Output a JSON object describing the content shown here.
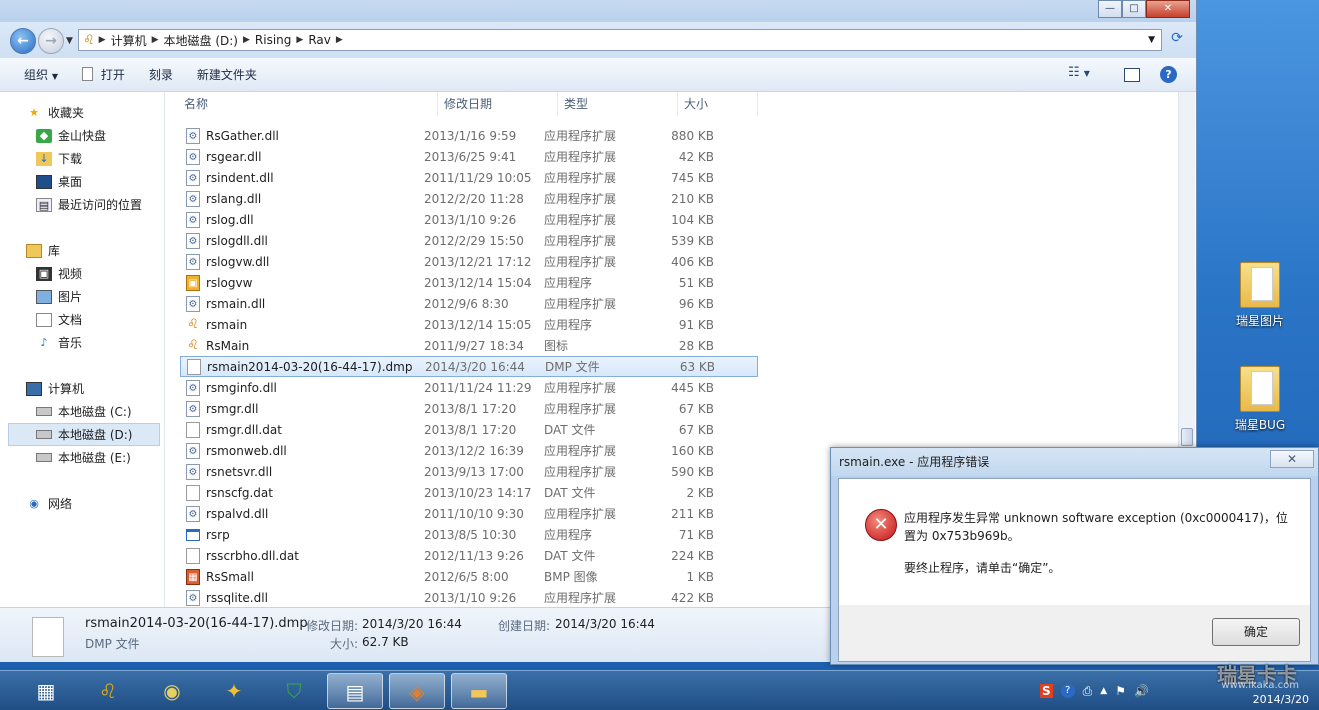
{
  "desktop": {
    "icons": [
      {
        "label": "瑞星图片"
      },
      {
        "label": "瑞星BUG"
      }
    ]
  },
  "explorer": {
    "window_buttons": {
      "minimize": "—",
      "maximize": "□",
      "close": "✕"
    },
    "address": {
      "crumbs": [
        "计算机",
        "本地磁盘 (D:)",
        "Rising",
        "Rav"
      ]
    },
    "toolbar": {
      "organize": "组织",
      "open": "打开",
      "burn": "刻录",
      "new_folder": "新建文件夹"
    },
    "nav": {
      "favorites": "收藏夹",
      "kingsoft": "金山快盘",
      "downloads": "下载",
      "desktop": "桌面",
      "recent": "最近访问的位置",
      "libraries": "库",
      "videos": "视频",
      "pictures": "图片",
      "documents": "文档",
      "music": "音乐",
      "computer": "计算机",
      "drive_c": "本地磁盘 (C:)",
      "drive_d": "本地磁盘 (D:)",
      "drive_e": "本地磁盘 (E:)",
      "network": "网络"
    },
    "columns": {
      "name": "名称",
      "date": "修改日期",
      "type": "类型",
      "size": "大小"
    },
    "files": [
      {
        "name": "RsGather.dll",
        "date": "2013/1/16 9:59",
        "type": "应用程序扩展",
        "size": "880 KB",
        "icon": "dll"
      },
      {
        "name": "rsgear.dll",
        "date": "2013/6/25 9:41",
        "type": "应用程序扩展",
        "size": "42 KB",
        "icon": "dll"
      },
      {
        "name": "rsindent.dll",
        "date": "2011/11/29 10:05",
        "type": "应用程序扩展",
        "size": "745 KB",
        "icon": "dll"
      },
      {
        "name": "rslang.dll",
        "date": "2012/2/20 11:28",
        "type": "应用程序扩展",
        "size": "210 KB",
        "icon": "dll"
      },
      {
        "name": "rslog.dll",
        "date": "2013/1/10 9:26",
        "type": "应用程序扩展",
        "size": "104 KB",
        "icon": "dll"
      },
      {
        "name": "rslogdll.dll",
        "date": "2012/2/29 15:50",
        "type": "应用程序扩展",
        "size": "539 KB",
        "icon": "dll"
      },
      {
        "name": "rslogvw.dll",
        "date": "2013/12/21 17:12",
        "type": "应用程序扩展",
        "size": "406 KB",
        "icon": "dll"
      },
      {
        "name": "rslogvw",
        "date": "2013/12/14 15:04",
        "type": "应用程序",
        "size": "51 KB",
        "icon": "exe"
      },
      {
        "name": "rsmain.dll",
        "date": "2012/9/6 8:30",
        "type": "应用程序扩展",
        "size": "96 KB",
        "icon": "dll"
      },
      {
        "name": "rsmain",
        "date": "2013/12/14 15:05",
        "type": "应用程序",
        "size": "91 KB",
        "icon": "lion"
      },
      {
        "name": "RsMain",
        "date": "2011/9/27 18:34",
        "type": "图标",
        "size": "28 KB",
        "icon": "lion"
      },
      {
        "name": "rsmain2014-03-20(16-44-17).dmp",
        "date": "2014/3/20 16:44",
        "type": "DMP 文件",
        "size": "63 KB",
        "icon": "file"
      },
      {
        "name": "rsmginfo.dll",
        "date": "2011/11/24 11:29",
        "type": "应用程序扩展",
        "size": "445 KB",
        "icon": "dll"
      },
      {
        "name": "rsmgr.dll",
        "date": "2013/8/1 17:20",
        "type": "应用程序扩展",
        "size": "67 KB",
        "icon": "dll"
      },
      {
        "name": "rsmgr.dll.dat",
        "date": "2013/8/1 17:20",
        "type": "DAT 文件",
        "size": "67 KB",
        "icon": "file"
      },
      {
        "name": "rsmonweb.dll",
        "date": "2013/12/2 16:39",
        "type": "应用程序扩展",
        "size": "160 KB",
        "icon": "dll"
      },
      {
        "name": "rsnetsvr.dll",
        "date": "2013/9/13 17:00",
        "type": "应用程序扩展",
        "size": "590 KB",
        "icon": "dll"
      },
      {
        "name": "rsnscfg.dat",
        "date": "2013/10/23 14:17",
        "type": "DAT 文件",
        "size": "2 KB",
        "icon": "file"
      },
      {
        "name": "rspalvd.dll",
        "date": "2011/10/10 9:30",
        "type": "应用程序扩展",
        "size": "211 KB",
        "icon": "dll"
      },
      {
        "name": "rsrp",
        "date": "2013/8/5 10:30",
        "type": "应用程序",
        "size": "71 KB",
        "icon": "window"
      },
      {
        "name": "rsscrbho.dll.dat",
        "date": "2012/11/13 9:26",
        "type": "DAT 文件",
        "size": "224 KB",
        "icon": "file"
      },
      {
        "name": "RsSmall",
        "date": "2012/6/5 8:00",
        "type": "BMP 图像",
        "size": "1 KB",
        "icon": "bmp"
      },
      {
        "name": "rssqlite.dll",
        "date": "2013/1/10 9:26",
        "type": "应用程序扩展",
        "size": "422 KB",
        "icon": "dll"
      }
    ],
    "details": {
      "filename": "rsmain2014-03-20(16-44-17).dmp",
      "filetype": "DMP 文件",
      "modified_label": "修改日期:",
      "modified_value": "2014/3/20 16:44",
      "created_label": "创建日期:",
      "created_value": "2014/3/20 16:44",
      "size_label": "大小:",
      "size_value": "62.7 KB"
    }
  },
  "dialog": {
    "title": "rsmain.exe - 应用程序错误",
    "close": "✕",
    "message_line1": "应用程序发生异常 unknown software exception (0xc0000417)，位置为 0x753b969b。",
    "message_line2": "要终止程序，请单击“确定”。",
    "ok": "确定"
  },
  "taskbar": {
    "clock_date": "2014/3/20",
    "watermark": "瑞星卡卡",
    "watermark_url": "www.ikaka.com"
  }
}
